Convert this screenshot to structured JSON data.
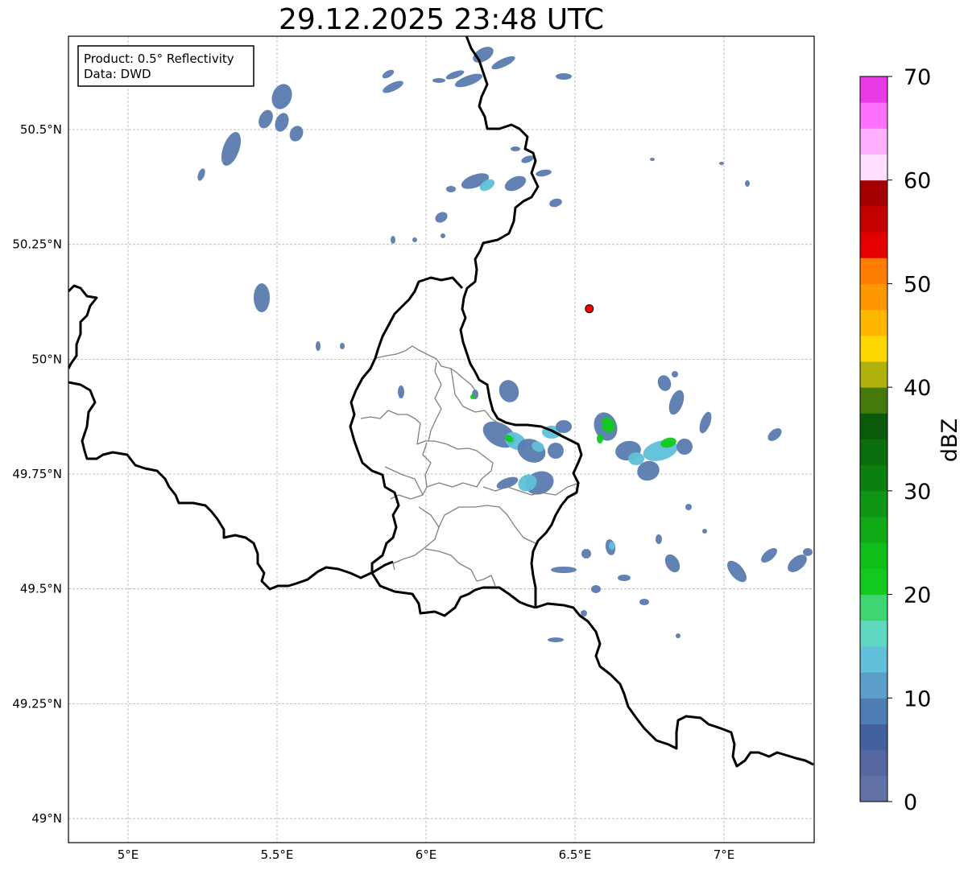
{
  "title": "29.12.2025 23:48 UTC",
  "info_box": {
    "product": "Product: 0.5° Reflectivity",
    "data": "Data: DWD"
  },
  "lon_ticks": [
    {
      "value": 5.0,
      "label": "5°E"
    },
    {
      "value": 5.5,
      "label": "5.5°E"
    },
    {
      "value": 6.0,
      "label": "6°E"
    },
    {
      "value": 6.5,
      "label": "6.5°E"
    },
    {
      "value": 7.0,
      "label": "7°E"
    }
  ],
  "lat_ticks": [
    {
      "value": 50.5,
      "label": "50.5°N"
    },
    {
      "value": 50.25,
      "label": "50.25°N"
    },
    {
      "value": 50.0,
      "label": "50°N"
    },
    {
      "value": 49.75,
      "label": "49.75°N"
    },
    {
      "value": 49.5,
      "label": "49.5°N"
    },
    {
      "value": 49.25,
      "label": "49.25°N"
    },
    {
      "value": 49.0,
      "label": "49°N"
    }
  ],
  "extent": {
    "lon_min": 4.8,
    "lon_max": 7.3,
    "lat_min": 48.95,
    "lat_max": 50.7
  },
  "radar_site": {
    "lon": 6.548,
    "lat": 50.11,
    "color": "#ff0000"
  },
  "colorbar": {
    "label": "dBZ",
    "min": 0,
    "max": 70,
    "ticks": [
      "0",
      "10",
      "20",
      "30",
      "40",
      "50",
      "60",
      "70"
    ],
    "colors": [
      "#6272a6",
      "#5467a0",
      "#43609f",
      "#4d7db2",
      "#5a9ec9",
      "#62c0da",
      "#5fd7c1",
      "#3ed672",
      "#12c91e",
      "#0fbe18",
      "#0faa15",
      "#0d9513",
      "#0b8010",
      "#0a6d0e",
      "#0a5a0c",
      "#457a0a",
      "#b0b10c",
      "#ffd700",
      "#ffb700",
      "#ff9800",
      "#ff7d00",
      "#e50000",
      "#c50000",
      "#a50000",
      "#7f0000",
      "#ffdeff",
      "#ffb0ff",
      "#ff70ff",
      "#e93ae8"
    ]
  },
  "legend_colors": {
    "echo_weak": "#5a7bb0",
    "echo_mid": "#5fc0d8",
    "echo_strong": "#12c91e"
  }
}
